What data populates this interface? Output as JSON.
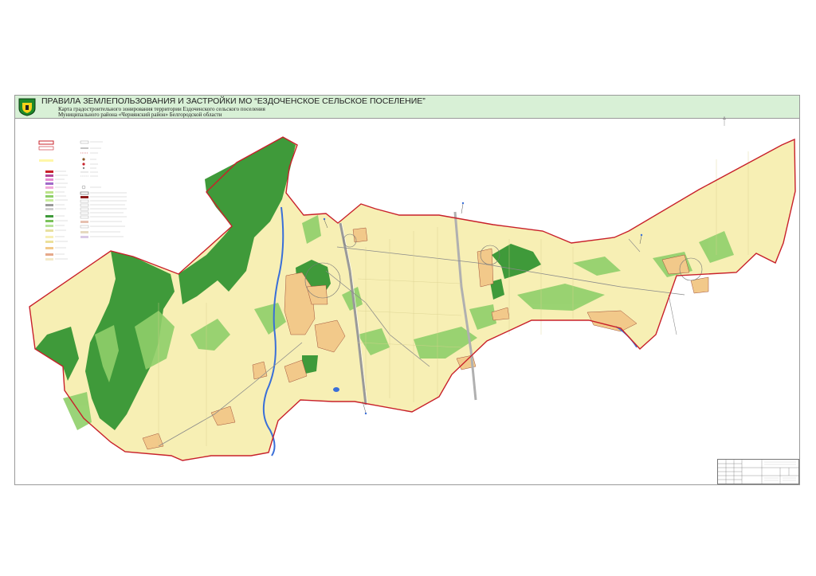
{
  "header": {
    "title": "ПРАВИЛА ЗЕМЛЕПОЛЬЗОВАНИЯ И ЗАСТРОЙКИ МО “ЕЗДОЧЕНСКОЕ СЕЛЬСКОЕ ПОСЕЛЕНИЕ”",
    "subtitle_line1": "Карта градостроительного зонирования территории Ездоченского сельского поселения",
    "subtitle_line2": "Муниципального района «Чернянский район» Белгородской области"
  },
  "colors": {
    "boundary": "#c8202a",
    "forest": "#3f9a3a",
    "meadow": "#8fcf6a",
    "field": "#f7efb4",
    "settlement": "#f2c98a",
    "water": "#3a6fd8",
    "road": "#8a8a8a",
    "header_band": "#d8f0d6"
  },
  "icons": [
    "coat-of-arms-icon",
    "compass-north-icon"
  ]
}
